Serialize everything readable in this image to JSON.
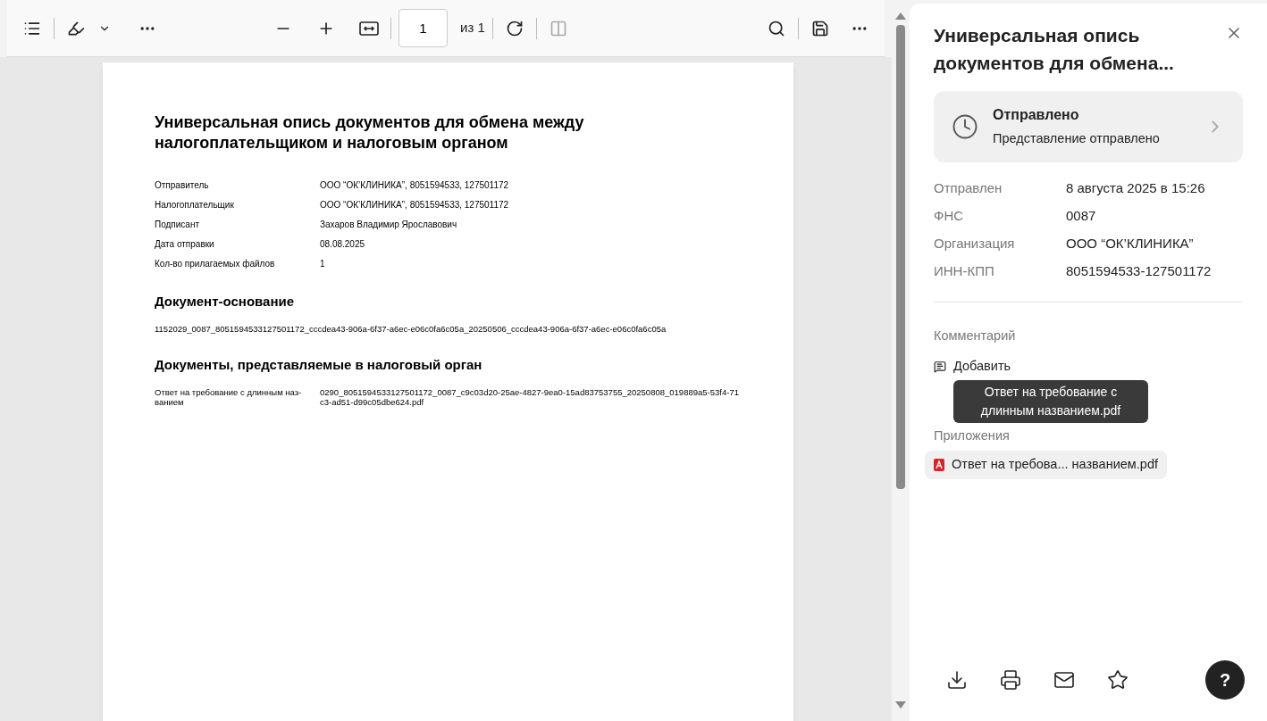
{
  "toolbar": {
    "page_input": "1",
    "page_total": "из 1"
  },
  "document": {
    "title": "Универсальная опись документов для обмена между налогоплательщиком и налоговым органом",
    "fields": [
      {
        "label": "Отправитель",
        "value": "ООО “ОК’КЛИНИКА”, 8051594533, 127501172"
      },
      {
        "label": "Налогоплательщик",
        "value": "ООО “ОК’КЛИНИКА”, 8051594533, 127501172"
      },
      {
        "label": "Подписант",
        "value": "Захаров Владимир Ярославович"
      },
      {
        "label": "Дата отправки",
        "value": "08.08.2025"
      },
      {
        "label": "Кол-во прилагаемых файлов",
        "value": "1"
      }
    ],
    "basis_heading": "Документ-основание",
    "basis_value": "1152029_0087_8051594533127501172_cccdea43-906a-6f37-a6ec-e06c0fa6c05a_20250506_cccdea43-906a-6f37-a6ec-e06c0fa6c05a",
    "docs_heading": "Документы, представляемые в налоговый орган",
    "docs": [
      {
        "label": "Ответ на требование с длинным наз-ванием",
        "value": "0290_8051594533127501172_0087_c9c03d20-25ae-4827-9ea0-15ad83753755_20250808_019889a5-53f4-71c3-ad51-d99c05dbe624.pdf"
      }
    ]
  },
  "panel": {
    "title": "Универсальная опись документов для обмена...",
    "status": {
      "title": "Отправлено",
      "subtitle": "Представление отправлено"
    },
    "details": [
      {
        "label": "Отправлен",
        "value": "8 августа 2025 в 15:26"
      },
      {
        "label": "ФНС",
        "value": "0087"
      },
      {
        "label": "Организация",
        "value": "ООО “ОК’КЛИНИКА”"
      },
      {
        "label": "ИНН-КПП",
        "value": "8051594533-127501172"
      }
    ],
    "comment_label": "Комментарий",
    "comment_add": "Добавить",
    "attachments_label": "Приложения",
    "attachments": [
      {
        "name": "Ответ на требова... названием.pdf"
      }
    ],
    "tooltip": "Ответ на требование с длинным названием.pdf",
    "help": "?"
  }
}
